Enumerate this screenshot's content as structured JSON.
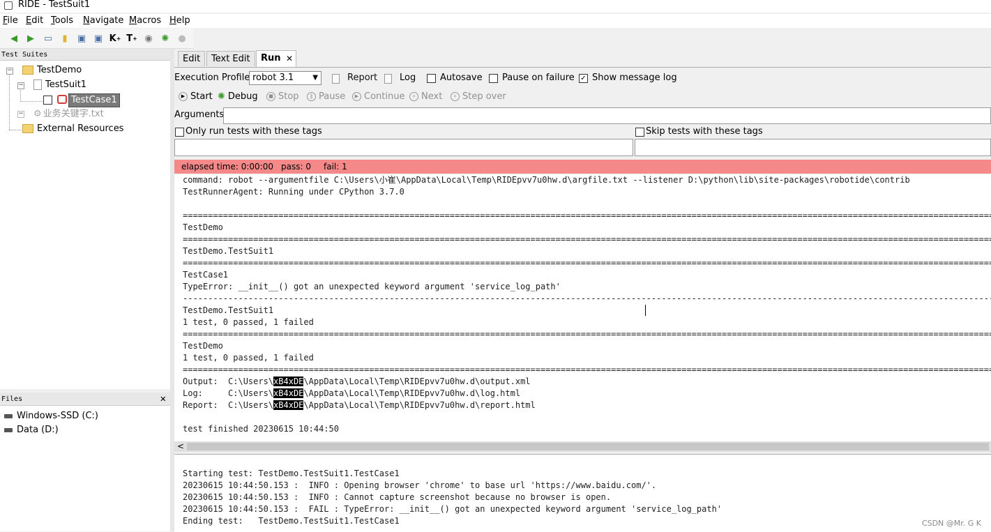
{
  "window": {
    "title": "RIDE - TestSuit1"
  },
  "menu": {
    "items": [
      {
        "label": "File",
        "underline": "F",
        "rest": "ile"
      },
      {
        "label": "Edit",
        "underline": "E",
        "rest": "dit"
      },
      {
        "label": "Tools",
        "underline": "T",
        "rest": "ools"
      },
      {
        "label": "Navigate",
        "underline": "N",
        "rest": "avigate"
      },
      {
        "label": "Macros",
        "underline": "M",
        "rest": "acros"
      },
      {
        "label": "Help",
        "underline": "H",
        "rest": "elp"
      }
    ]
  },
  "toolbar": {
    "k_label": "K",
    "t_label": "T",
    "k_sup": "+",
    "t_sup": "+"
  },
  "suites": {
    "header": "Test Suites",
    "tree": {
      "root": "TestDemo",
      "suite": "TestSuit1",
      "testcase": "TestCase1",
      "resource_file": "业务关键字.txt",
      "external": "External Resources"
    }
  },
  "files": {
    "header": "Files",
    "close": "✕",
    "drives": [
      "Windows-SSD (C:)",
      "Data (D:)"
    ]
  },
  "tabs": {
    "edit": "Edit",
    "text_edit": "Text Edit",
    "run": "Run",
    "run_close": "✕"
  },
  "run": {
    "profile_label": "Execution Profile:",
    "profile_value": "robot 3.1",
    "report": "Report",
    "log": "Log",
    "autosave": "Autosave",
    "pause_on_failure": "Pause on failure",
    "show_message_log": "Show message log",
    "start": "Start",
    "debug": "Debug",
    "stop": "Stop",
    "pause": "Pause",
    "continue": "Continue",
    "next": "Next",
    "step_over": "Step over",
    "arguments_label": "Arguments:",
    "only_run_tags": "Only run tests with these tags",
    "skip_tags": "Skip tests with these tags"
  },
  "status": {
    "elapsed": "elapsed time: 0:00:00",
    "pass": "pass: 0",
    "fail": "fail: 1",
    "color": "#f58989"
  },
  "console": {
    "command": "command: robot --argumentfile C:\\Users\\小崔\\AppData\\Local\\Temp\\RIDEpvv7u0hw.d\\argfile.txt --listener D:\\python\\lib\\site-packages\\robotide\\contrib",
    "agent": "TestRunnerAgent: Running under CPython 3.7.0",
    "sep_eq": "==============================================================================================================================================================================================",
    "sep_dash": "------------------------------------------------------------------------------------------------------------------------------------------------------------------------------------------------",
    "demo": "TestDemo",
    "suit": "TestDemo.TestSuit1",
    "case": "TestCase1",
    "error": "TypeError: __init__() got an unexpected keyword argument 'service_log_path'",
    "suit_end": "TestDemo.TestSuit1",
    "suit_stats": "1 test, 0 passed, 1 failed",
    "demo_end": "TestDemo",
    "demo_stats": "1 test, 0 passed, 1 failed",
    "output_pre": "Output:  C:\\Users\\",
    "log_pre": "Log:     C:\\Users\\",
    "report_pre": "Report:  C:\\Users\\",
    "hl1": "xB4",
    "hl2": "xDE",
    "output_path": "\\AppData\\Local\\Temp\\RIDEpvv7u0hw.d\\output.xml",
    "log_path": "\\AppData\\Local\\Temp\\RIDEpvv7u0hw.d\\log.html",
    "report_path": "\\AppData\\Local\\Temp\\RIDEpvv7u0hw.d\\report.html",
    "finished": "test finished 20230615 10:44:50"
  },
  "message_log": {
    "lines": [
      "Starting test: TestDemo.TestSuit1.TestCase1",
      "20230615 10:44:50.153 :  INFO : Opening browser 'chrome' to base url 'https://www.baidu.com/'.",
      "20230615 10:44:50.153 :  INFO : Cannot capture screenshot because no browser is open.",
      "20230615 10:44:50.153 :  FAIL : TypeError: __init__() got an unexpected keyword argument 'service_log_path'",
      "Ending test:   TestDemo.TestSuit1.TestCase1"
    ]
  },
  "watermark": "CSDN @Mr. G K"
}
